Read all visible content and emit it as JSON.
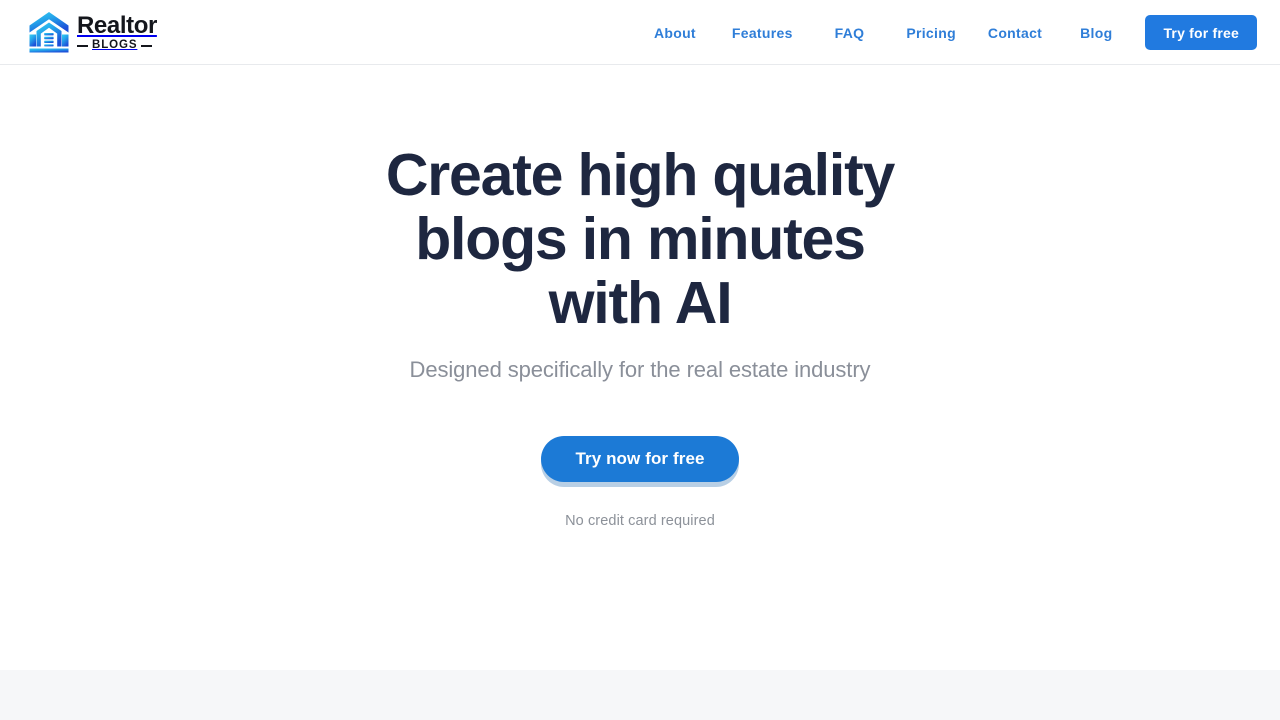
{
  "header": {
    "logo": {
      "icon": "house-document-logo-icon",
      "name": "Realtor",
      "sub": "BLOGS"
    },
    "nav_items": [
      {
        "label": "About",
        "name": "nav-link-about"
      },
      {
        "label": "Features",
        "name": "nav-link-features"
      },
      {
        "label": "FAQ",
        "name": "nav-link-faq"
      },
      {
        "label": "Pricing",
        "name": "nav-link-pricing"
      },
      {
        "label": "Contact",
        "name": "nav-link-contact"
      },
      {
        "label": "Blog",
        "name": "nav-link-blog"
      }
    ],
    "cta_label": "Try for free"
  },
  "hero": {
    "headline": "Create high quality blogs in minutes with AI",
    "subheadline": "Designed specifically for the real estate industry",
    "cta_label": "Try now for free",
    "fineprint": "No credit card required"
  },
  "colors": {
    "accent_blue": "#217ae0",
    "nav_link_blue": "#2f7ed8",
    "cta_blue": "#1c7ad6",
    "headline_navy": "#1e2740",
    "muted_gray": "#8a8f99",
    "band_gray": "#f6f7f9",
    "logo_cyan": "#2ec8f0",
    "logo_blue": "#1f5fe0"
  }
}
